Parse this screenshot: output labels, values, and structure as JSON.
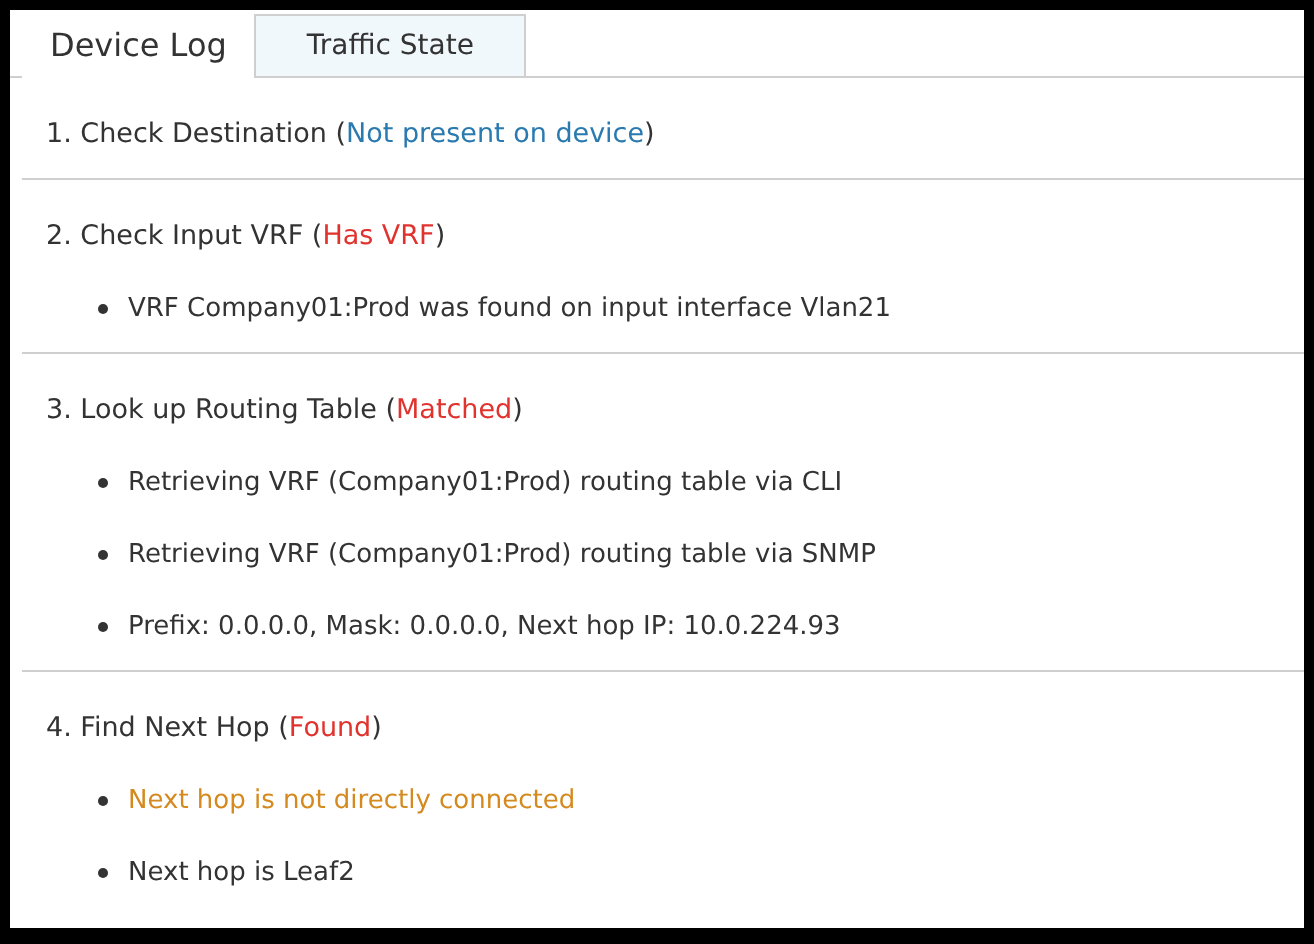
{
  "tabs": [
    {
      "label": "Device Log",
      "selected": true
    },
    {
      "label": "Traffic State",
      "selected": false
    }
  ],
  "steps": [
    {
      "title": "1. Check Destination (",
      "status": "Not present on device",
      "color": "#2a7ab0",
      "suffix": ")"
    },
    {
      "title": "2. Check Input VRF (",
      "status": "Has VRF",
      "color": "#e0332e",
      "suffix": ")",
      "details": [
        {
          "text": "VRF Company01:Prod was found on input interface Vlan21",
          "kind": "info"
        }
      ]
    },
    {
      "title": "3. Look up Routing Table (",
      "status": "Matched",
      "color": "#e0332e",
      "suffix": ")",
      "details": [
        {
          "text": "Retrieving VRF (Company01:Prod) routing table via CLI",
          "kind": "info"
        },
        {
          "text": "Retrieving VRF (Company01:Prod) routing table via SNMP",
          "kind": "info"
        },
        {
          "text": "Prefix: 0.0.0.0, Mask: 0.0.0.0, Next hop IP: 10.0.224.93",
          "kind": "info"
        }
      ]
    },
    {
      "title": "4. Find Next Hop (",
      "status": "Found",
      "color": "#e0332e",
      "suffix": ")",
      "details": [
        {
          "text": "Next hop is not directly connected",
          "kind": "warning"
        },
        {
          "text": "Next hop is Leaf2",
          "kind": "info"
        }
      ]
    }
  ]
}
